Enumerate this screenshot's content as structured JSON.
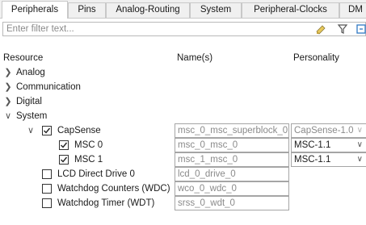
{
  "tabs": [
    {
      "label": "Peripherals"
    },
    {
      "label": "Pins"
    },
    {
      "label": "Analog-Routing"
    },
    {
      "label": "System"
    },
    {
      "label": "Peripheral-Clocks"
    },
    {
      "label": "DM"
    }
  ],
  "filter": {
    "placeholder": "Enter filter text..."
  },
  "columns": {
    "resource": "Resource",
    "names": "Name(s)",
    "personality": "Personality"
  },
  "tree": {
    "analog": {
      "label": "Analog"
    },
    "communication": {
      "label": "Communication"
    },
    "digital": {
      "label": "Digital"
    },
    "system": {
      "label": "System"
    },
    "capsense": {
      "label": "CapSense",
      "name": "msc_0_msc_superblock_0",
      "personality": "CapSense-1.0",
      "checked": true
    },
    "msc0": {
      "label": "MSC 0",
      "name": "msc_0_msc_0",
      "personality": "MSC-1.1",
      "checked": true
    },
    "msc1": {
      "label": "MSC 1",
      "name": "msc_1_msc_0",
      "personality": "MSC-1.1",
      "checked": true
    },
    "lcd": {
      "label": "LCD Direct Drive 0",
      "name": "lcd_0_drive_0",
      "checked": false
    },
    "wdc": {
      "label": "Watchdog Counters (WDC)",
      "name": "wco_0_wdc_0",
      "checked": false
    },
    "wdt": {
      "label": "Watchdog Timer (WDT)",
      "name": "srss_0_wdt_0",
      "checked": false
    }
  }
}
